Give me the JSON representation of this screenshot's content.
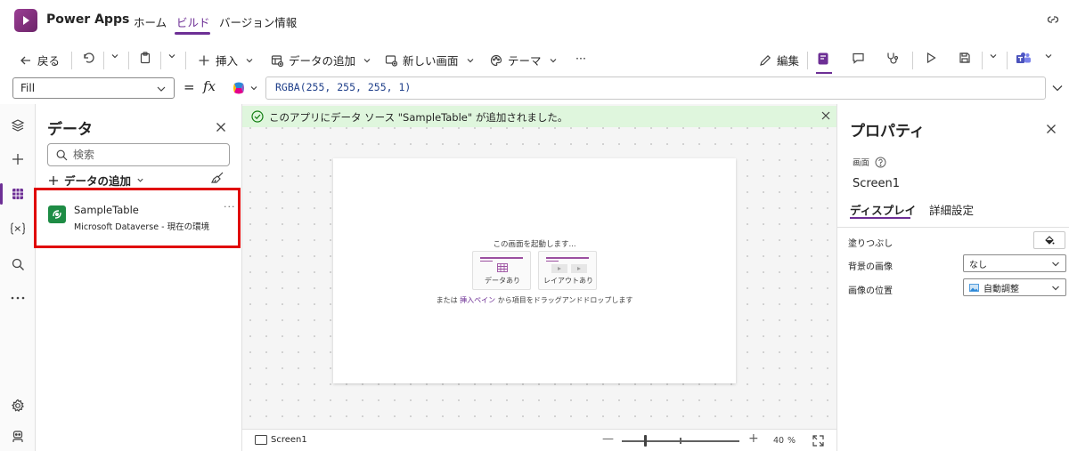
{
  "header": {
    "app_name": "Power Apps",
    "tabs": [
      {
        "label": "ホーム"
      },
      {
        "label": "ビルド"
      },
      {
        "label": "バージョン情報"
      }
    ]
  },
  "commands": {
    "back": "戻る",
    "insert": "挿入",
    "add_data": "データの追加",
    "new_screen": "新しい画面",
    "theme": "テーマ",
    "more": "···",
    "edit": "編集"
  },
  "formula": {
    "property": "Fill",
    "equals": "=",
    "fx": "fx",
    "value": "RGBA(255, 255, 255, 1)"
  },
  "data_pane": {
    "title": "データ",
    "search_placeholder": "検索",
    "add_data": "データの追加",
    "tables": [
      {
        "name": "SampleTable",
        "source": "Microsoft Dataverse - 現在の環境",
        "more": "···"
      }
    ]
  },
  "canvas": {
    "notification": "このアプリにデータ ソース \"SampleTable\" が追加されました。",
    "start_text": "この画面を起動します...",
    "layouts": [
      {
        "label": "データあり"
      },
      {
        "label": "レイアウトあり"
      }
    ],
    "or_prefix": "または",
    "or_link": "挿入ペイン",
    "or_suffix": "から項目をドラッグアンドドロップします"
  },
  "footer": {
    "screen_name": "Screen1",
    "zoom_minus": "—",
    "zoom_plus": "+",
    "zoom_value": "40",
    "zoom_unit": "%",
    "zoom_level": 0.2
  },
  "properties": {
    "title": "プロパティ",
    "type": "画面",
    "name": "Screen1",
    "tabs": [
      {
        "label": "ディスプレイ"
      },
      {
        "label": "詳細設定"
      }
    ],
    "rows": [
      {
        "label": "塗りつぶし"
      },
      {
        "label": "背景の画像",
        "value": "なし"
      },
      {
        "label": "画像の位置",
        "value": "自動調整"
      }
    ]
  },
  "colors": {
    "accent": "#6d2f95",
    "highlight_box": "#e00000",
    "notification_bg": "#dff6dd",
    "dataverse_green": "#1e8c45"
  }
}
